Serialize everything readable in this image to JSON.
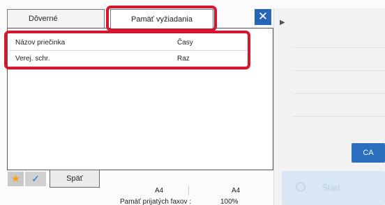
{
  "tabs": {
    "left": "Dôverné",
    "right": "Pamäť vyžiadania"
  },
  "close_icon": "close-icon",
  "list": [
    {
      "name": "Názov priečinka",
      "value": "Časy"
    },
    {
      "name": "Verej. schr.",
      "value": "Raz"
    }
  ],
  "right_panel": {
    "ca_label": "CA",
    "start_label": "Štart"
  },
  "bottom": {
    "back_label": "Späť",
    "paper_left": "A4",
    "paper_right": "A4",
    "memory_label": "Pamäť prijatých faxov :",
    "memory_value": "100%"
  },
  "colors": {
    "highlight": "#d6162f",
    "accent": "#2766b7"
  }
}
